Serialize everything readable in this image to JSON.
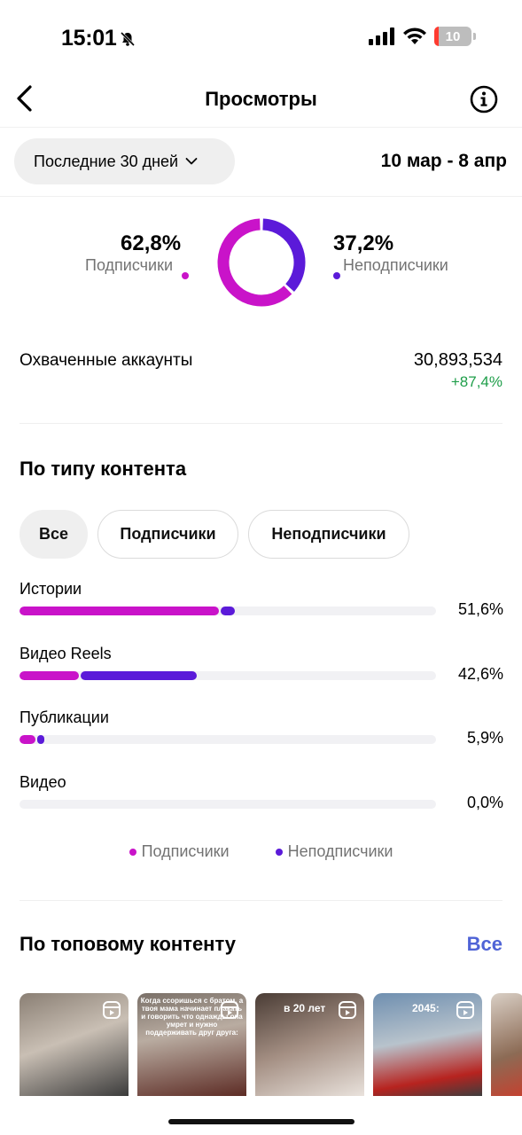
{
  "status": {
    "time": "15:01",
    "battery": "10"
  },
  "nav": {
    "title": "Просмотры"
  },
  "filter": {
    "period": "Последние 30 дней",
    "date_range": "10 мар - 8 апр"
  },
  "audience_split": {
    "subscribers_pct": "62,8%",
    "subscribers_label": "Подписчики",
    "non_subscribers_pct": "37,2%",
    "non_subscribers_label": "Неподписчики",
    "subscribers_value": 62.8,
    "non_subscribers_value": 37.2
  },
  "reach": {
    "label": "Охваченные аккаунты",
    "value": "30,893,534",
    "change": "+87,4%"
  },
  "content_type": {
    "title": "По типу контента",
    "tabs": [
      {
        "label": "Все",
        "active": true
      },
      {
        "label": "Подписчики",
        "active": false
      },
      {
        "label": "Неподписчики",
        "active": false
      }
    ],
    "rows": [
      {
        "label": "Истории",
        "pct": "51,6%",
        "total": 51.6,
        "subscribers_share": 0.93
      },
      {
        "label": "Видео Reels",
        "pct": "42,6%",
        "total": 42.6,
        "subscribers_share": 0.34
      },
      {
        "label": "Публикации",
        "pct": "5,9%",
        "total": 5.9,
        "subscribers_share": 0.68
      },
      {
        "label": "Видео",
        "pct": "0,0%",
        "total": 0.0,
        "subscribers_share": 0
      }
    ],
    "legend": {
      "subscribers": "Подписчики",
      "non_subscribers": "Неподписчики"
    }
  },
  "top_content": {
    "title": "По топовому контенту",
    "see_all": "Все",
    "thumbnails": [
      {
        "caption": ""
      },
      {
        "caption": "Когда ссоришься с братом, а твоя мама начинает плакать и говорить что однажды она умрет и нужно поддерживать друг друга:"
      },
      {
        "caption": "в 20 лет"
      },
      {
        "caption": "2045:"
      },
      {
        "caption": ""
      }
    ]
  },
  "colors": {
    "subscribers": "#c913c9",
    "non_subscribers": "#5b1ad9",
    "positive": "#1f9e4a",
    "link": "#4f63d6"
  }
}
